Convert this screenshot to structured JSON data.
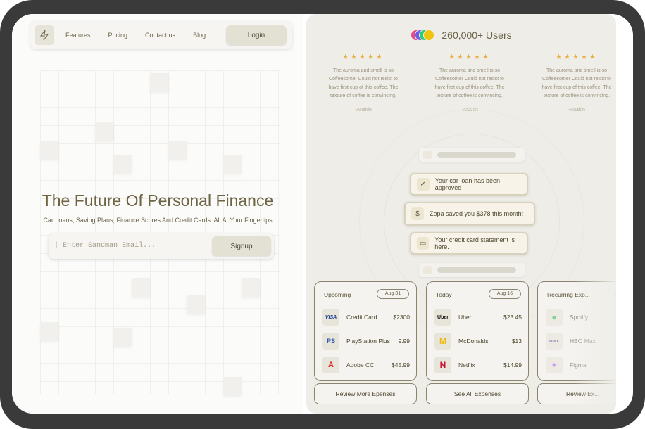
{
  "nav": {
    "links": [
      "Features",
      "Pricing",
      "Contact us",
      "Blog"
    ],
    "login_label": "Login"
  },
  "hero": {
    "title": "The Future Of Personal Finance",
    "subtitle": "Car Loans, Saving Plans, Finance Scores And Credit Cards. All At Your Fingertips",
    "email_prefix": "| Enter",
    "email_struck": "Sandman",
    "email_suffix": "Email...",
    "signup_label": "Signup"
  },
  "users": {
    "count_label": "260,000+  Users",
    "avatar_colors": [
      "#e84d8a",
      "#6c5ce7",
      "#2ecc71",
      "#f1c40f"
    ]
  },
  "reviews": [
    {
      "stars": "★★★★★",
      "text": "The auroma and smell is so Coffeesome! Could not resist to have first cup of this coffee. The texture of coffee is convincing.",
      "author": "-Anakin"
    },
    {
      "stars": "★★★★★",
      "text": "The auroma and smell is so Coffeesome! Could not resist to have first cup of this coffee. The texture of coffee is convincing.",
      "author": "-Anakin"
    },
    {
      "stars": "★★★★★",
      "text": "The auroma and smell is so Coffeesome! Could not resist to have first cup of this coffee. The texture of coffee is convincing.",
      "author": "-Anakin"
    }
  ],
  "notifications": [
    {
      "icon": "check-icon",
      "glyph": "✓",
      "text": "Your car loan has been approved"
    },
    {
      "icon": "dollar-icon",
      "glyph": "$",
      "text": "Zopa saved you $378 this month!"
    },
    {
      "icon": "card-icon",
      "glyph": "▭",
      "text": "Your credit card statement is here."
    }
  ],
  "cards": [
    {
      "title": "Upcoming",
      "badge": "Aug 31",
      "rows": [
        {
          "icon": "visa-icon",
          "logo": "VISA",
          "name": "Credit Card",
          "amount": "$2300"
        },
        {
          "icon": "playstation-icon",
          "logo": "PS",
          "name": "PlayStation Plus",
          "amount": "9.99"
        },
        {
          "icon": "adobe-icon",
          "logo": "A",
          "name": "Adobe CC",
          "amount": "$45.99"
        }
      ],
      "button": "Review More Epenses"
    },
    {
      "title": "Today",
      "badge": "Aug 16",
      "rows": [
        {
          "icon": "uber-icon",
          "logo": "Uber",
          "name": "Uber",
          "amount": "$23.45"
        },
        {
          "icon": "mcdonalds-icon",
          "logo": "M",
          "name": "McDonalds",
          "amount": "$13"
        },
        {
          "icon": "netflix-icon",
          "logo": "N",
          "name": "Netflix",
          "amount": "$14.99"
        }
      ],
      "button": "See All Expenses"
    },
    {
      "title": "Recurring Exp...",
      "badge": "",
      "rows": [
        {
          "icon": "spotify-icon",
          "logo": "●",
          "name": "Spotify",
          "amount": ""
        },
        {
          "icon": "hbo-max-icon",
          "logo": "max",
          "name": "HBO Max",
          "amount": ""
        },
        {
          "icon": "figma-icon",
          "logo": "✦",
          "name": "Figma",
          "amount": ""
        }
      ],
      "button": "Review Ex..."
    }
  ]
}
